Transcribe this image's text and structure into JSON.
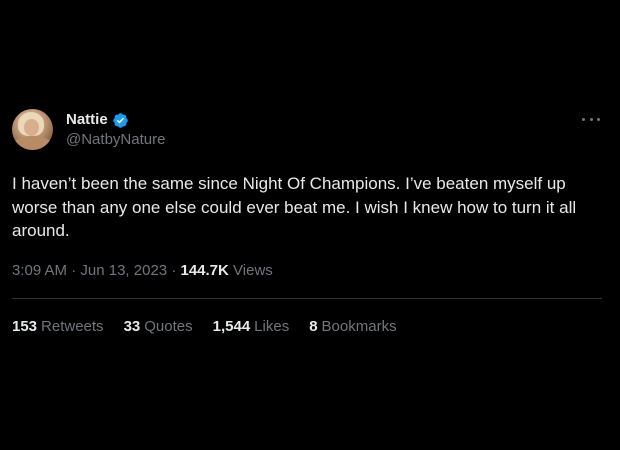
{
  "colors": {
    "background": "#000000",
    "text_primary": "#e7e9ea",
    "text_secondary": "#71767b",
    "verified_badge": "#1d9bf0",
    "divider": "#2f3336"
  },
  "author": {
    "display_name": "Nattie",
    "handle": "@NatbyNature",
    "verified_icon": "verified-badge-icon",
    "avatar_icon": "profile-avatar"
  },
  "menu": {
    "icon": "more-options-icon"
  },
  "tweet": {
    "text": "I haven’t been the same since Night Of Champions. I’ve beaten myself up worse than any one else could ever beat me. I wish I knew how to turn it all around."
  },
  "meta": {
    "time": "3:09 AM",
    "separator": "·",
    "date": "Jun 13, 2023",
    "views_count": "144.7K",
    "views_label": "Views"
  },
  "stats": {
    "retweets_count": "153",
    "retweets_label": "Retweets",
    "quotes_count": "33",
    "quotes_label": "Quotes",
    "likes_count": "1,544",
    "likes_label": "Likes",
    "bookmarks_count": "8",
    "bookmarks_label": "Bookmarks"
  }
}
